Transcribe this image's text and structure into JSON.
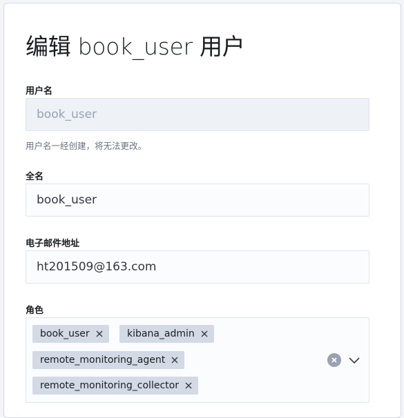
{
  "page": {
    "title": "编辑 book_user 用户"
  },
  "form": {
    "username": {
      "label": "用户名",
      "value": "book_user",
      "help": "用户名一经创建，将无法更改。"
    },
    "full_name": {
      "label": "全名",
      "value": "book_user"
    },
    "email": {
      "label": "电子邮件地址",
      "value": "ht201509@163.com"
    },
    "roles": {
      "label": "角色",
      "selected": [
        "book_user",
        "kibana_admin",
        "remote_monitoring_agent",
        "remote_monitoring_collector"
      ]
    }
  },
  "icons": {
    "remove_role": "cross-icon",
    "clear_all": "clear-circle-icon",
    "toggle_list": "chevron-down-icon"
  }
}
